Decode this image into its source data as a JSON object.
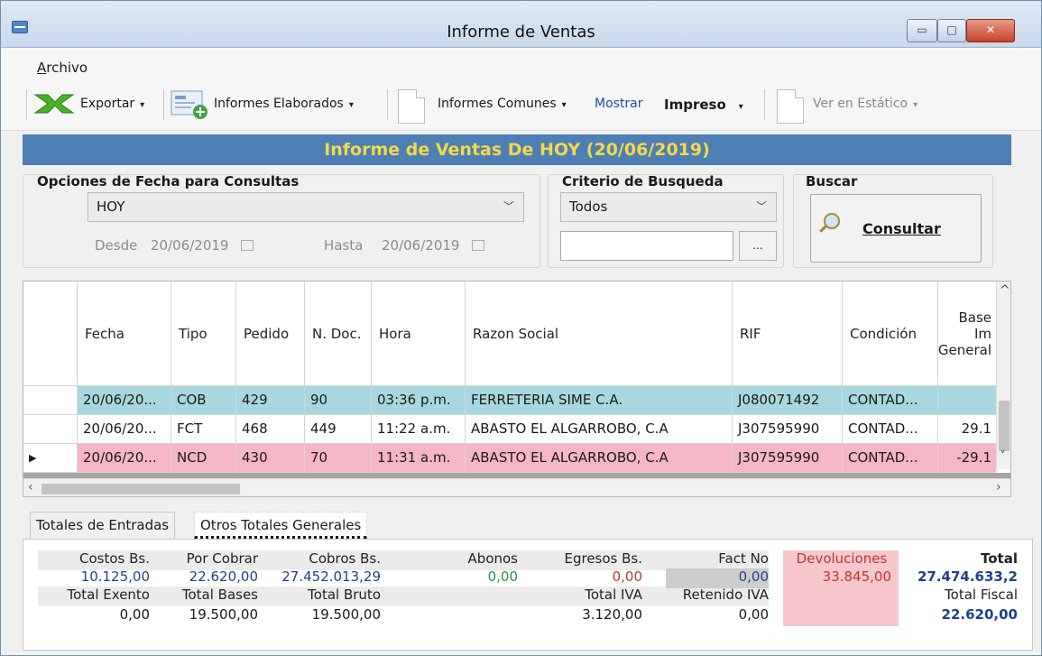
{
  "window": {
    "title": "Informe de Ventas",
    "min": "▭",
    "max": "□",
    "close": "✕"
  },
  "menu": {
    "archivo_first": "A",
    "archivo_rest": "rchivo"
  },
  "toolbar": {
    "exportar": "Exportar",
    "informes_elaborados": "Informes Elaborados",
    "informes_comunes": "Informes Comunes",
    "mostrar": "Mostrar",
    "impreso": "Impreso",
    "ver_estatico": "Ver en Estático",
    "caret": "▾"
  },
  "banner": "Informe de Ventas De HOY (20/06/2019)",
  "filters": {
    "fecha_title": "Opciones de Fecha para Consultas",
    "fecha_value": "HOY",
    "desde_label": "Desde",
    "desde_value": "20/06/2019",
    "hasta_label": "Hasta",
    "hasta_value": "20/06/2019",
    "criterio_title": "Criterio de Busqueda",
    "criterio_value": "Todos",
    "search_value": "",
    "ellipsis": "...",
    "buscar_title": "Buscar",
    "consultar_first": "C",
    "consultar_rest": "onsultar"
  },
  "grid": {
    "headers": [
      "Fecha",
      "Tipo",
      "Pedido",
      "N. Doc.",
      "Hora",
      "Razon Social",
      "RIF",
      "Condición",
      "Base Im General"
    ],
    "rows": [
      {
        "fecha": "20/06/20...",
        "tipo": "COB",
        "pedido": "429",
        "ndoc": "90",
        "hora": "03:36 p.m.",
        "razon": "FERRETERIA SIME C.A.",
        "rif": "J080071492",
        "cond": "CONTAD...",
        "base": ""
      },
      {
        "fecha": "20/06/20...",
        "tipo": "FCT",
        "pedido": "468",
        "ndoc": "449",
        "hora": "11:22 a.m.",
        "razon": "ABASTO EL ALGARROBO, C.A",
        "rif": "J307595990",
        "cond": "CONTAD...",
        "base": "29.1"
      },
      {
        "fecha": "20/06/20...",
        "tipo": "NCD",
        "pedido": "430",
        "ndoc": "70",
        "hora": "11:31 a.m.",
        "razon": "ABASTO EL ALGARROBO, C.A",
        "rif": "J307595990",
        "cond": "CONTAD...",
        "base": "-29.1"
      }
    ],
    "current_row_marker": "▶"
  },
  "tabs": [
    "Totales de Entradas",
    "Otros Totales Generales"
  ],
  "totals": {
    "costos_label": "Costos Bs.",
    "costos_value": "10.125,00",
    "porcobrar_label": "Por Cobrar",
    "porcobrar_value": "22.620,00",
    "cobros_label": "Cobros Bs.",
    "cobros_value": "27.452.013,29",
    "abonos_label": "Abonos",
    "abonos_value": "0,00",
    "egresos_label": "Egresos Bs.",
    "egresos_value": "0,00",
    "factno_label": "Fact No",
    "factno_value": "0,00",
    "devol_label": "Devoluciones",
    "devol_value": "33.845,00",
    "total_label": "Total",
    "total_value": "27.474.633,2",
    "exento_label": "Total Exento",
    "exento_value": "0,00",
    "bases_label": "Total Bases",
    "bases_value": "19.500,00",
    "bruto_label": "Total Bruto",
    "bruto_value": "19.500,00",
    "iva_label": "Total IVA",
    "iva_value": "3.120,00",
    "retenido_label": "Retenido IVA",
    "retenido_value": "0,00",
    "fiscal_label": "Total Fiscal",
    "fiscal_value": "22.620,00"
  }
}
